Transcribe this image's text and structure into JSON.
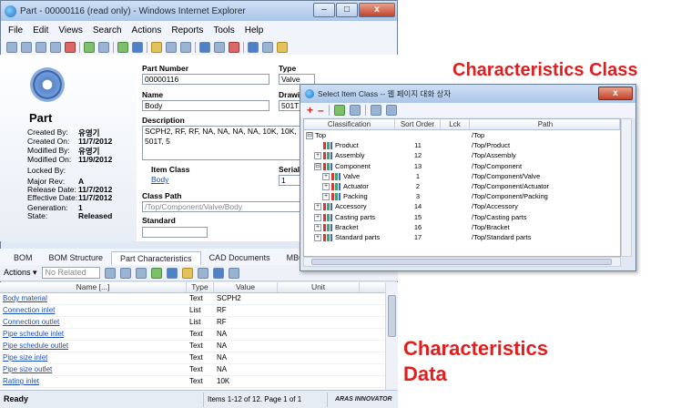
{
  "window": {
    "title": "Part - 00000116 (read only) - Windows Internet Explorer",
    "min": "–",
    "max": "□",
    "close": "x"
  },
  "menu": [
    "File",
    "Edit",
    "Views",
    "Search",
    "Actions",
    "Reports",
    "Tools",
    "Help"
  ],
  "item": {
    "type_label": "Part",
    "labels": {
      "created_by": "Created By:",
      "created_on": "Created On:",
      "modified_by": "Modified By:",
      "modified_on": "Modified On:",
      "locked_by": "Locked By:",
      "major_rev": "Major Rev:",
      "release_date": "Release Date:",
      "effective_date": "Effective Date:",
      "generation": "Generation:",
      "state": "State:"
    },
    "values": {
      "created_by": "유영기",
      "created_on": "11/7/2012",
      "modified_by": "유영기",
      "modified_on": "11/9/2012",
      "locked_by": "",
      "major_rev": "A",
      "release_date": "11/7/2012",
      "effective_date": "11/7/2012",
      "generation": "1",
      "state": "Released"
    }
  },
  "fields": {
    "part_number_label": "Part Number",
    "part_number": "00000116",
    "type_label": "Type",
    "type": "Valve",
    "name_label": "Name",
    "name": "Body",
    "drawing_label": "Drawi",
    "drawing": "501TN",
    "description_label": "Description",
    "description": "SCPH2, RF, RF, NA, NA, NA, NA, 10K, 10K, 501T, 5",
    "item_class_label": "Item Class",
    "item_class": "Body",
    "serial_label": "Serial",
    "serial": "1",
    "class_path_label": "Class Path",
    "class_path": "/Top/Component/Valve/Body",
    "standard_label": "Standard",
    "standard": ""
  },
  "tabs": [
    "BOM",
    "BOM Structure",
    "Part Characteristics",
    "CAD Documents",
    "MBO"
  ],
  "gridbar": {
    "actions": "Actions ▾",
    "filter": "No Related"
  },
  "grid": {
    "headers": [
      "Name [...]",
      "Type",
      "Value",
      "Unit"
    ],
    "rows": [
      [
        "Body material",
        "Text",
        "SCPH2",
        ""
      ],
      [
        "Connection inlet",
        "List",
        "RF",
        ""
      ],
      [
        "Connection outlet",
        "List",
        "RF",
        ""
      ],
      [
        "Pipe schedule inlet",
        "Text",
        "NA",
        ""
      ],
      [
        "Pipe schedule outlet",
        "Text",
        "NA",
        ""
      ],
      [
        "Pipe size inlet",
        "Text",
        "NA",
        ""
      ],
      [
        "Pipe size outlet",
        "Text",
        "NA",
        ""
      ],
      [
        "Rating inlet",
        "Text",
        "10K",
        ""
      ]
    ]
  },
  "status": {
    "ready": "Ready",
    "paging": "Items 1-12 of 12. Page 1 of 1",
    "logo": "ARAS INNOVATOR"
  },
  "dialog": {
    "title": "Select Item Class -- 웹 페이지 대화 상자",
    "close": "x",
    "headers": [
      "Classification",
      "Sort Order",
      "Lck",
      "Path"
    ],
    "rows": [
      {
        "name": "Top",
        "order": "",
        "lck": "",
        "path": "/Top",
        "level": 0,
        "node": "⊟",
        "icon": false
      },
      {
        "name": "Product",
        "order": "11",
        "lck": "",
        "path": "/Top/Product",
        "level": 1,
        "node": "",
        "icon": true
      },
      {
        "name": "Assembly",
        "order": "12",
        "lck": "",
        "path": "/Top/Assembly",
        "level": 1,
        "node": "+",
        "icon": true
      },
      {
        "name": "Component",
        "order": "13",
        "lck": "",
        "path": "/Top/Component",
        "level": 1,
        "node": "⊟",
        "icon": true
      },
      {
        "name": "Valve",
        "order": "1",
        "lck": "",
        "path": "/Top/Component/Valve",
        "level": 2,
        "node": "+",
        "icon": true
      },
      {
        "name": "Actuator",
        "order": "2",
        "lck": "",
        "path": "/Top/Component/Actuator",
        "level": 2,
        "node": "+",
        "icon": true
      },
      {
        "name": "Packing",
        "order": "3",
        "lck": "",
        "path": "/Top/Component/Packing",
        "level": 2,
        "node": "+",
        "icon": true
      },
      {
        "name": "Accessory",
        "order": "14",
        "lck": "",
        "path": "/Top/Accessory",
        "level": 1,
        "node": "+",
        "icon": true
      },
      {
        "name": "Casting parts",
        "order": "15",
        "lck": "",
        "path": "/Top/Casting parts",
        "level": 1,
        "node": "+",
        "icon": true
      },
      {
        "name": "Bracket",
        "order": "16",
        "lck": "",
        "path": "/Top/Bracket",
        "level": 1,
        "node": "+",
        "icon": true
      },
      {
        "name": "Standard parts",
        "order": "17",
        "lck": "",
        "path": "/Top/Standard parts",
        "level": 1,
        "node": "+",
        "icon": true
      }
    ]
  },
  "annotations": {
    "class_label": "Characteristics Class",
    "data_line1": "Characteristics",
    "data_line2": "Data"
  },
  "colors": {
    "annotation": "#e21d1d",
    "link": "#1c4fb8"
  }
}
